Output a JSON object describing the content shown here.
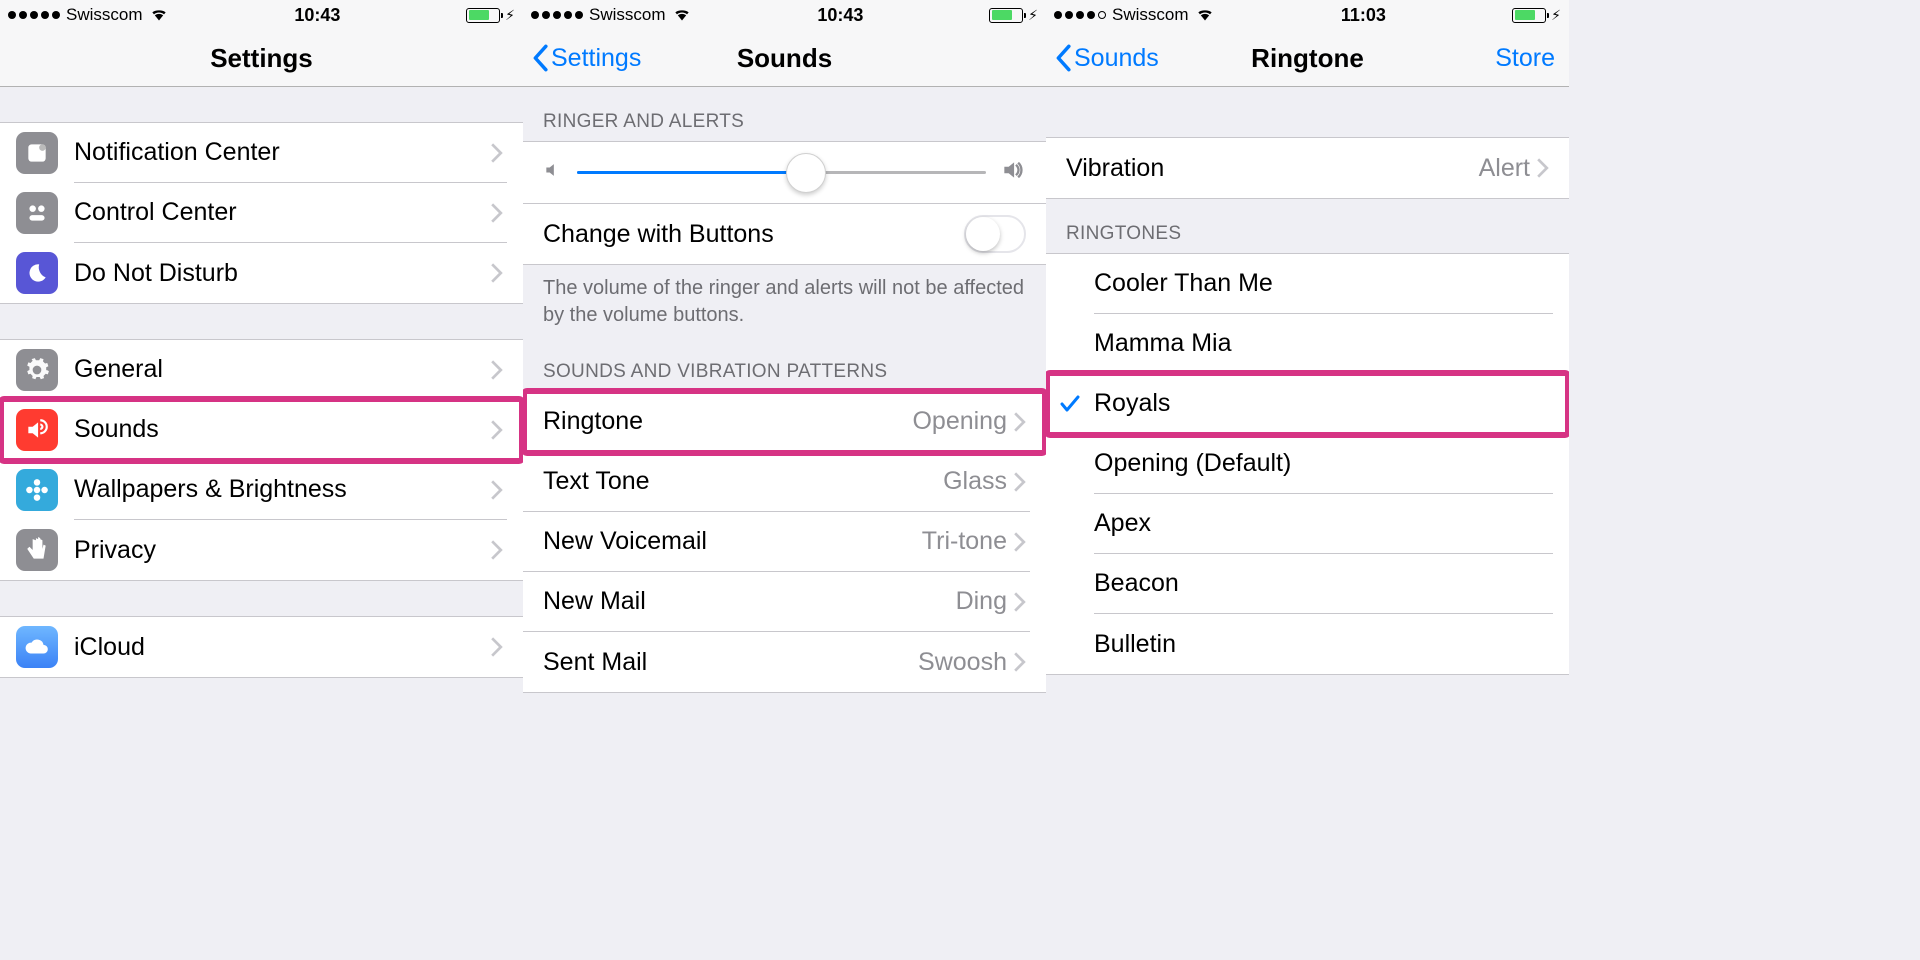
{
  "screen1": {
    "status": {
      "carrier": "Swisscom",
      "time": "10:43",
      "signal_full": 5
    },
    "nav": {
      "title": "Settings"
    },
    "group1": [
      {
        "label": "Notification Center"
      },
      {
        "label": "Control Center"
      },
      {
        "label": "Do Not Disturb"
      }
    ],
    "group2": [
      {
        "label": "General"
      },
      {
        "label": "Sounds",
        "highlighted": true
      },
      {
        "label": "Wallpapers & Brightness"
      },
      {
        "label": "Privacy"
      }
    ],
    "group3_partial": "iCloud"
  },
  "screen2": {
    "status": {
      "carrier": "Swisscom",
      "time": "10:43",
      "signal_full": 5
    },
    "nav": {
      "back": "Settings",
      "title": "Sounds"
    },
    "section1_header": "RINGER AND ALERTS",
    "slider_percent": 56,
    "change_buttons_label": "Change with Buttons",
    "footer": "The volume of the ringer and alerts will not be affected by the volume buttons.",
    "section2_header": "SOUNDS AND VIBRATION PATTERNS",
    "rows": [
      {
        "label": "Ringtone",
        "value": "Opening",
        "highlighted": true
      },
      {
        "label": "Text Tone",
        "value": "Glass"
      },
      {
        "label": "New Voicemail",
        "value": "Tri-tone"
      },
      {
        "label": "New Mail",
        "value": "Ding"
      },
      {
        "label": "Sent Mail",
        "value": "Swoosh"
      }
    ]
  },
  "screen3": {
    "status": {
      "carrier": "Swisscom",
      "time": "11:03",
      "signal_full": 4
    },
    "nav": {
      "back": "Sounds",
      "title": "Ringtone",
      "right": "Store"
    },
    "vibration": {
      "label": "Vibration",
      "value": "Alert"
    },
    "section_header": "RINGTONES",
    "ringtones": [
      {
        "label": "Cooler Than Me",
        "selected": false
      },
      {
        "label": "Mamma Mia",
        "selected": false
      },
      {
        "label": "Royals",
        "selected": true,
        "highlighted": true
      },
      {
        "label": "Opening (Default)",
        "selected": false
      },
      {
        "label": "Apex",
        "selected": false
      },
      {
        "label": "Beacon",
        "selected": false
      },
      {
        "label": "Bulletin",
        "selected": false
      }
    ]
  }
}
